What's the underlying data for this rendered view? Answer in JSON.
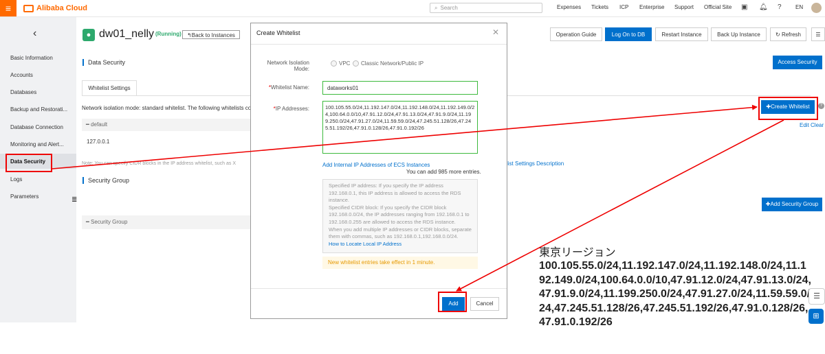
{
  "topbar": {
    "brand": "Alibaba Cloud",
    "search_placeholder": "Search",
    "nav": [
      "Expenses",
      "Tickets",
      "ICP",
      "Enterprise",
      "Support",
      "Official Site"
    ],
    "lang": "EN"
  },
  "sidebar": {
    "items": [
      {
        "label": "Basic Information"
      },
      {
        "label": "Accounts"
      },
      {
        "label": "Databases"
      },
      {
        "label": "Backup and Restorati..."
      },
      {
        "label": "Database Connection"
      },
      {
        "label": "Monitoring and Alert..."
      },
      {
        "label": "Data Security"
      },
      {
        "label": "Logs"
      },
      {
        "label": "Parameters"
      }
    ]
  },
  "instance": {
    "name": "dw01_nelly",
    "status": "(Running)",
    "back_label": "Back to Instances"
  },
  "toolbar": {
    "operation_guide": "Operation Guide",
    "log_on_db": "Log On to DB",
    "restart": "Restart Instance",
    "backup": "Back Up Instance",
    "refresh": "Refresh"
  },
  "main": {
    "data_security_title": "Data Security",
    "access_security": "Access Security",
    "tab_whitelist": "Whitelist Settings",
    "mode_text": "Network isolation mode: standard whitelist. The following whitelists cont",
    "default_group": "default",
    "default_ip": "127.0.0.1",
    "note_text": "Note: You can specify CIDR blocks in the IP address whitelist, such as X",
    "desc_link": "list Settings Description",
    "create_whitelist": "Create Whitelist",
    "edit_clear": "Edit Clear",
    "security_group_title": "Security Group",
    "add_security_group": "Add Security Group",
    "security_group_bar": "Security Group"
  },
  "modal": {
    "title": "Create Whitelist",
    "network_label_line1": "Network Isolation",
    "network_label_line2": "Mode:",
    "opt_vpc": "VPC",
    "opt_classic": "Classic Network/Public IP",
    "name_label": "Whitelist Name:",
    "name_value": "dataworks01",
    "ip_label": "IP Addresses:",
    "ip_value": "100.105.55.0/24,11.192.147.0/24,11.192.148.0/24,11.192.149.0/24,100.64.0.0/10,47.91.12.0/24,47.91.13.0/24,47.91.9.0/24,11.199.250.0/24,47.91.27.0/24,11.59.59.0/24,47.245.51.128/26,47.245.51.192/26,47.91.0.128/26,47.91.0.192/26",
    "add_ecs_link": "Add Internal IP Addresses of ECS Instances",
    "remaining": "You can add 985 more entries.",
    "tips": [
      "Specified IP address: If you specify the IP address 192.168.0.1, this IP address is allowed to access the RDS instance.",
      "Specified CIDR block: If you specify the CIDR block 192.168.0.0/24, the IP addresses ranging from 192.168.0.1 to 192.168.0.255 are allowed to access the RDS instance.",
      "When you add multiple IP addresses or CIDR blocks, separate them with commas, such as 192.168.0.1,192.168.0.0/24."
    ],
    "tips_link": "How to Locate Local IP Address",
    "notice": "New whitelist entries take effect in 1 minute.",
    "add": "Add",
    "cancel": "Cancel"
  },
  "annotation": {
    "title": "東京リージョン",
    "ips": "100.105.55.0/24,11.192.147.0/24,11.192.148.0/24,11.192.149.0/24,100.64.0.0/10,47.91.12.0/24,47.91.13.0/24,47.91.9.0/24,11.199.250.0/24,47.91.27.0/24,11.59.59.0/24,47.245.51.128/26,47.245.51.192/26,47.91.0.128/26,47.91.0.192/26"
  },
  "colors": {
    "brand": "#ff6a00",
    "primary": "#0070cc",
    "highlight": "#e00000",
    "success": "#2da96d"
  }
}
